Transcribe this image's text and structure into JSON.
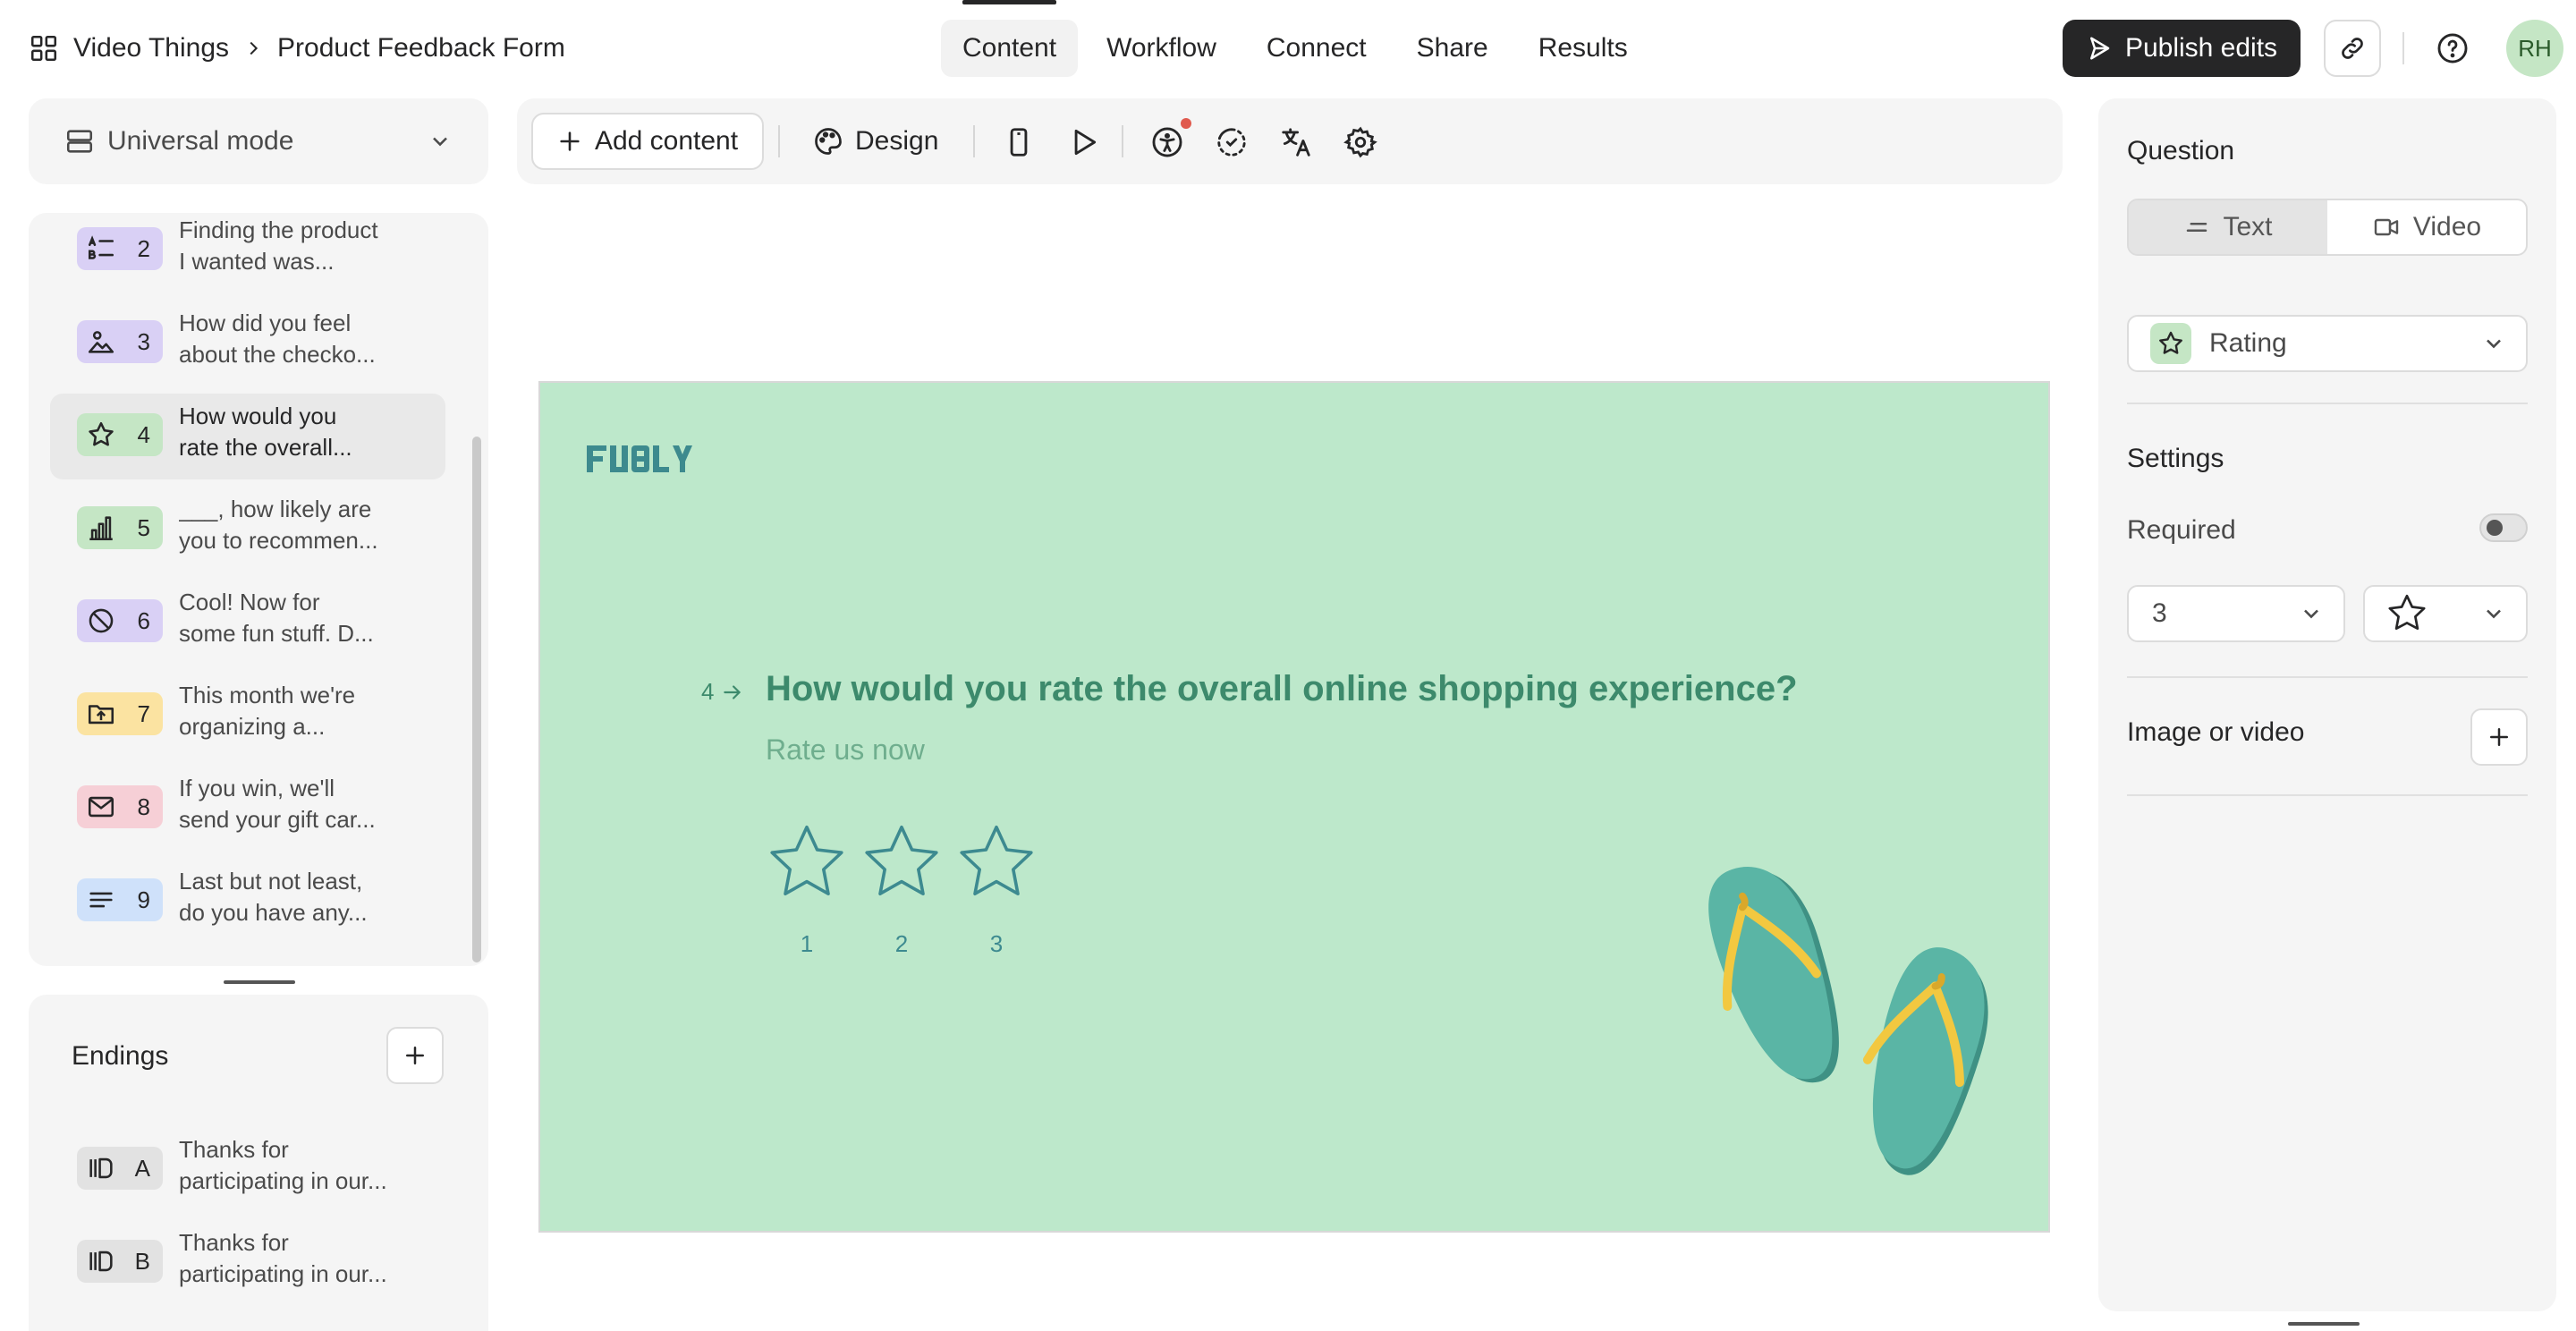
{
  "breadcrumb": {
    "workspace": "Video Things",
    "form": "Product Feedback Form"
  },
  "nav_tabs": [
    {
      "label": "Content",
      "active": true
    },
    {
      "label": "Workflow",
      "active": false
    },
    {
      "label": "Connect",
      "active": false
    },
    {
      "label": "Share",
      "active": false
    },
    {
      "label": "Results",
      "active": false
    }
  ],
  "header": {
    "publish_label": "Publish edits",
    "avatar_initials": "RH"
  },
  "mode_selector": {
    "label": "Universal mode"
  },
  "questions": [
    {
      "num": "2",
      "icon": "checklist-icon",
      "color": "#d9d0f5",
      "line1": "Finding the product",
      "line2": "I wanted was..."
    },
    {
      "num": "3",
      "icon": "image-icon",
      "color": "#d9d0f5",
      "line1": "How did you feel",
      "line2": "about the checko..."
    },
    {
      "num": "4",
      "icon": "star-icon",
      "color": "#c5e6c5",
      "line1": "How would you",
      "line2": "rate the overall...",
      "selected": true
    },
    {
      "num": "5",
      "icon": "bar-chart-icon",
      "color": "#c5e6c5",
      "line1": "___, how likely are",
      "line2": "you to recommen..."
    },
    {
      "num": "6",
      "icon": "no-symbol-icon",
      "color": "#d9d0f5",
      "line1": "Cool! Now for",
      "line2": "some fun stuff. D..."
    },
    {
      "num": "7",
      "icon": "folder-upload-icon",
      "color": "#fbe3a1",
      "line1": "This month we're",
      "line2": "organizing a..."
    },
    {
      "num": "8",
      "icon": "mail-icon",
      "color": "#f6cfd6",
      "line1": "If you win, we'll",
      "line2": "send your gift car..."
    },
    {
      "num": "9",
      "icon": "text-lines-icon",
      "color": "#cfe1fa",
      "line1": "Last but not least,",
      "line2": "do you have any..."
    }
  ],
  "endings": {
    "title": "Endings",
    "items": [
      {
        "letter": "A",
        "icon": "ending-icon",
        "color": "#e2e2e2",
        "line1": "Thanks for",
        "line2": "participating in our..."
      },
      {
        "letter": "B",
        "icon": "ending-icon",
        "color": "#e2e2e2",
        "line1": "Thanks for",
        "line2": "participating in our..."
      }
    ]
  },
  "toolbar": {
    "add_content_label": "Add content",
    "design_label": "Design"
  },
  "canvas": {
    "background": "#bde8cb",
    "question_number": "4",
    "question_title": "How would you rate the overall online shopping experience?",
    "question_description": "Rate us now",
    "rating_labels": [
      "1",
      "2",
      "3"
    ]
  },
  "right_panel": {
    "question_title": "Question",
    "text_label": "Text",
    "video_label": "Video",
    "type_label": "Rating",
    "settings_title": "Settings",
    "required_label": "Required",
    "required_on": false,
    "rating_count": "3",
    "shape_icon": "star-icon",
    "image_video_label": "Image or video"
  }
}
